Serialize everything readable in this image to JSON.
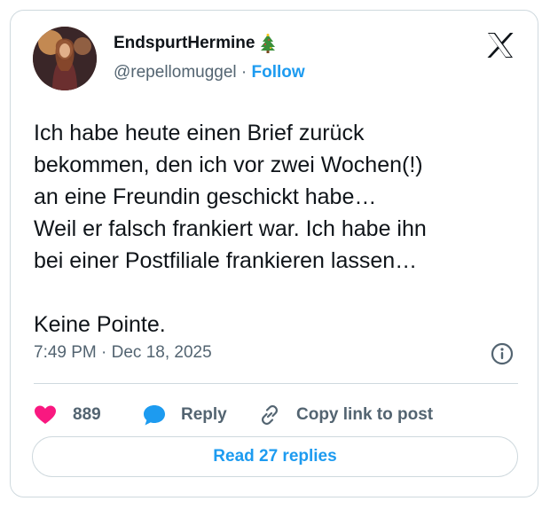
{
  "author": {
    "display_name": "EndspurtHermine",
    "handle": "@repellomuggel",
    "separator": "·",
    "follow_label": "Follow",
    "name_emoji": "christmas-tree-icon"
  },
  "post": {
    "lines": [
      "Ich habe heute einen Brief zurück",
      "bekommen, den ich vor zwei Wochen(!)",
      "an eine Freundin geschickt habe…",
      "Weil er falsch frankiert war. Ich habe ihn",
      "bei einer Postfiliale frankieren lassen…",
      "Keine Pointe."
    ],
    "timestamp": "7:49 PM · Dec 18, 2025"
  },
  "actions": {
    "like_count": "889",
    "reply_label": "Reply",
    "copy_label": "Copy link to post"
  },
  "footer": {
    "read_replies_label": "Read 27 replies"
  },
  "colors": {
    "accent": "#1d9bf0",
    "like": "#f91880",
    "text": "#0f1419",
    "muted": "#536471",
    "border": "#cfd9de"
  },
  "icons": [
    "x-logo-icon",
    "info-icon",
    "heart-icon",
    "reply-bubble-icon",
    "link-icon"
  ]
}
